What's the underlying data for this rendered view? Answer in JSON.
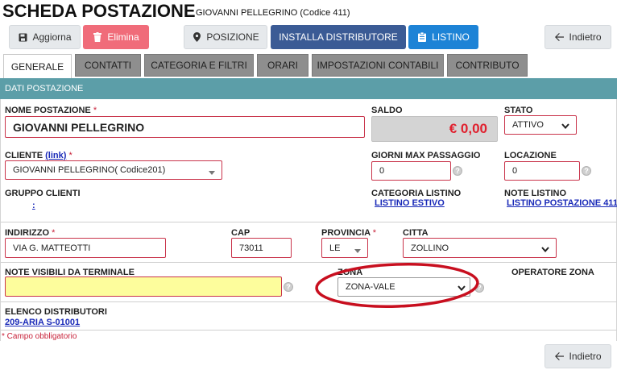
{
  "header": {
    "title": "SCHEDA POSTAZIONE",
    "subtitle": "GIOVANNI PELLEGRINO (Codice 411)"
  },
  "toolbar": {
    "aggiorna": "Aggiorna",
    "elimina": "Elimina",
    "posizione": "POSIZIONE",
    "installa": "INSTALLA DISTRIBUTORE",
    "listino": "LISTINO",
    "indietro": "Indietro"
  },
  "tabs": [
    "GENERALE",
    "CONTATTI",
    "CATEGORIA E FILTRI",
    "ORARI",
    "IMPOSTAZIONI CONTABILI",
    "CONTRIBUTO"
  ],
  "section": {
    "title": "DATI POSTAZIONE"
  },
  "form": {
    "nome_postazione": {
      "label": "NOME POSTAZIONE",
      "value": "GIOVANNI PELLEGRINO"
    },
    "saldo": {
      "label": "SALDO",
      "value": "€ 0,00"
    },
    "stato": {
      "label": "STATO",
      "value": "ATTIVO"
    },
    "cliente": {
      "label": "CLIENTE",
      "link": "(link)",
      "value": "GIOVANNI PELLEGRINO( Codice201)"
    },
    "giorni_max": {
      "label": "GIORNI MAX PASSAGGIO",
      "value": "0"
    },
    "locazione": {
      "label": "LOCAZIONE",
      "value": "0"
    },
    "gruppo_clienti": {
      "label": "GRUPPO CLIENTI",
      "value": ":"
    },
    "categoria_listino": {
      "label": "CATEGORIA LISTINO",
      "value": "LISTINO ESTIVO"
    },
    "note_listino": {
      "label": "NOTE LISTINO",
      "value": "LISTINO POSTAZIONE 411"
    },
    "indirizzo": {
      "label": "INDIRIZZO",
      "value": "VIA G. MATTEOTTI"
    },
    "cap": {
      "label": "CAP",
      "value": "73011"
    },
    "provincia": {
      "label": "PROVINCIA",
      "value": "LE"
    },
    "citta": {
      "label": "CITTA",
      "value": "ZOLLINO"
    },
    "note_visibili": {
      "label": "NOTE VISIBILI DA TERMINALE",
      "value": ""
    },
    "zona": {
      "label": "ZONA",
      "value": "ZONA-VALE"
    },
    "operatore_zona": {
      "label": "OPERATORE ZONA"
    },
    "elenco_distributori": {
      "label": "ELENCO DISTRIBUTORI",
      "value": "209-ARIA S-01001"
    },
    "required_note": "* Campo obbligatorio",
    "asterisk": "*",
    "help_glyph": "?"
  },
  "colors": {
    "section_header": "#5c9ea8",
    "danger": "#f06c7a",
    "navy": "#3b5b95",
    "blue": "#1d83d6",
    "saldo_text": "#e0202e",
    "annotation": "#c80f1f"
  }
}
